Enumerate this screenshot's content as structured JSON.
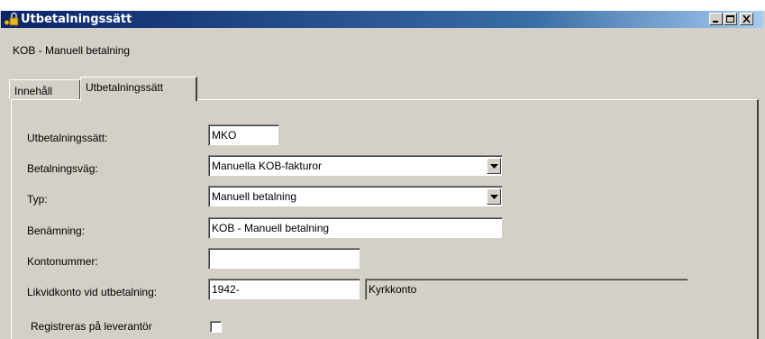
{
  "window": {
    "title": "Utbetalningssätt",
    "icon": "lock-key-icon",
    "controls": [
      "minimize",
      "maximize",
      "close"
    ]
  },
  "subtitle": "KOB - Manuell betalning",
  "tabs": [
    {
      "label": "Innehåll",
      "active": false
    },
    {
      "label": "Utbetalningssätt",
      "active": true
    }
  ],
  "form": {
    "utbetalningssatt": {
      "label": "Utbetalningssätt:",
      "value": "MKO"
    },
    "betalningsvag": {
      "label": "Betalningsväg:",
      "value": "Manuella KOB-fakturor"
    },
    "typ": {
      "label": "Typ:",
      "value": "Manuell betalning"
    },
    "benamning": {
      "label": "Benämning:",
      "value": "KOB - Manuell betalning"
    },
    "kontonummer": {
      "label": "Kontonummer:",
      "value": ""
    },
    "likvidkonto": {
      "label": "Likvidkonto vid utbetalning:",
      "value": "1942-",
      "description": "Kyrkkonto"
    },
    "registreras": {
      "label": "Registreras på leverantör",
      "checked": false
    }
  },
  "colors": {
    "titlebar_start": "#0a246a",
    "titlebar_end": "#a6caf0",
    "face": "#d4d0c8"
  }
}
